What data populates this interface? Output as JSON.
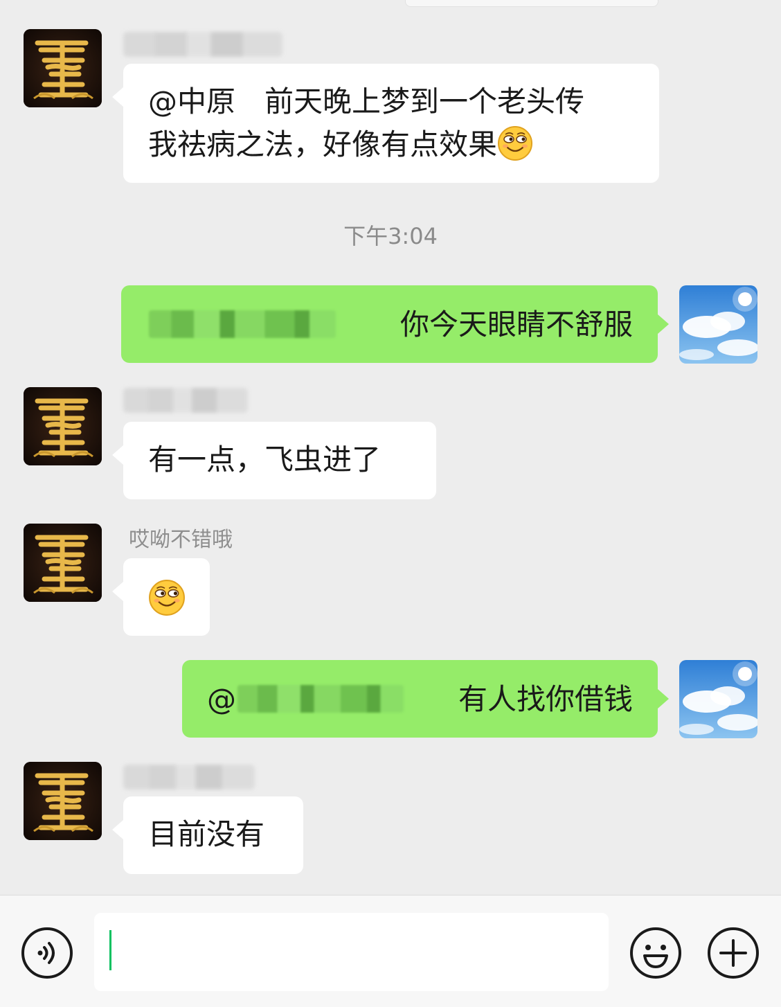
{
  "chat": {
    "messages": [
      {
        "sender": "other",
        "text_line1": "@中原　前天晚上梦到一个老头传",
        "text_line2": "我祛病之法，好像有点效果",
        "emoji": "smirk-emoji"
      },
      {
        "type": "time",
        "text": "下午3:04"
      },
      {
        "sender": "me",
        "text": "你今天眼睛不舒服"
      },
      {
        "sender": "other",
        "text": "有一点，飞虫进了"
      },
      {
        "sender": "other",
        "name": "哎呦不错哦",
        "emoji": "smirk-emoji"
      },
      {
        "sender": "me",
        "prefix": "@",
        "text": "有人找你借钱"
      },
      {
        "sender": "other",
        "text": "目前没有"
      }
    ]
  },
  "input_bar": {
    "voice_icon": "voice-icon",
    "emoji_icon": "emoji-icon",
    "plus_icon": "plus-icon",
    "input_value": ""
  },
  "colors": {
    "background": "#ededed",
    "my_bubble": "#95ec69",
    "their_bubble": "#ffffff",
    "caret": "#07c160"
  }
}
